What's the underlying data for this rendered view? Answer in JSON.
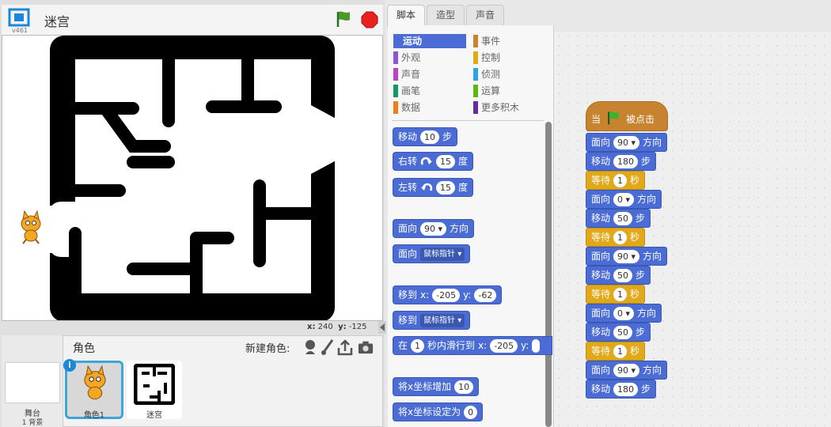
{
  "stage": {
    "title": "迷宫",
    "version": "v461",
    "coords": {
      "x_label": "x:",
      "x": "240",
      "y_label": "y:",
      "y": "-125"
    }
  },
  "sprites": {
    "title": "角色",
    "new_sprite_label": "新建角色:",
    "stage_label": "舞台",
    "backdrop_count": "1 背景",
    "items": [
      {
        "name": "角色1"
      },
      {
        "name": "迷宫"
      }
    ]
  },
  "tabs": [
    "脚本",
    "造型",
    "声音"
  ],
  "categories": [
    {
      "label": "运动",
      "color": "#4a6cd4"
    },
    {
      "label": "事件",
      "color": "#c88330"
    },
    {
      "label": "外观",
      "color": "#8a55d7"
    },
    {
      "label": "控制",
      "color": "#e1a91a"
    },
    {
      "label": "声音",
      "color": "#bb42c3"
    },
    {
      "label": "侦测",
      "color": "#2ca5e2"
    },
    {
      "label": "画笔",
      "color": "#0e9a6c"
    },
    {
      "label": "运算",
      "color": "#5cb712"
    },
    {
      "label": "数据",
      "color": "#ee7d16"
    },
    {
      "label": "更多积木",
      "color": "#632d99"
    }
  ],
  "palette_blocks": {
    "move": {
      "a": "移动",
      "v": "10",
      "b": "步"
    },
    "turn_right": {
      "a": "右转",
      "v": "15",
      "b": "度"
    },
    "turn_left": {
      "a": "左转",
      "v": "15",
      "b": "度"
    },
    "point_dir": {
      "a": "面向",
      "v": "90",
      "b": "方向"
    },
    "point_towards": {
      "a": "面向",
      "v": "鼠标指针"
    },
    "goto_xy": {
      "a": "移到",
      "x_label": "x:",
      "x": "-205",
      "y_label": "y:",
      "y": "-62"
    },
    "goto": {
      "a": "移到",
      "v": "鼠标指针"
    },
    "glide": {
      "a": "在",
      "v": "1",
      "b": "秒内滑行到",
      "x_label": "x:",
      "x": "-205",
      "y_label": "y:"
    },
    "change_x": {
      "a": "将x坐标增加",
      "v": "10"
    },
    "set_x": {
      "a": "将x坐标设定为",
      "v": "0"
    }
  },
  "script": {
    "hat": {
      "a": "当",
      "b": "被点击"
    },
    "blocks": [
      {
        "a": "面向",
        "v": "90",
        "b": "方向",
        "kind": "mot",
        "dd": true
      },
      {
        "a": "移动",
        "v": "180",
        "b": "步",
        "kind": "mot"
      },
      {
        "a": "等待",
        "v": "1",
        "b": "秒",
        "kind": "ctl"
      },
      {
        "a": "面向",
        "v": "0",
        "b": "方向",
        "kind": "mot",
        "dd": true
      },
      {
        "a": "移动",
        "v": "50",
        "b": "步",
        "kind": "mot"
      },
      {
        "a": "等待",
        "v": "1",
        "b": "秒",
        "kind": "ctl"
      },
      {
        "a": "面向",
        "v": "90",
        "b": "方向",
        "kind": "mot",
        "dd": true
      },
      {
        "a": "移动",
        "v": "50",
        "b": "步",
        "kind": "mot"
      },
      {
        "a": "等待",
        "v": "1",
        "b": "秒",
        "kind": "ctl"
      },
      {
        "a": "面向",
        "v": "0",
        "b": "方向",
        "kind": "mot",
        "dd": true
      },
      {
        "a": "移动",
        "v": "50",
        "b": "步",
        "kind": "mot"
      },
      {
        "a": "等待",
        "v": "1",
        "b": "秒",
        "kind": "ctl"
      },
      {
        "a": "面向",
        "v": "90",
        "b": "方向",
        "kind": "mot",
        "dd": true
      },
      {
        "a": "移动",
        "v": "180",
        "b": "步",
        "kind": "mot"
      }
    ]
  }
}
